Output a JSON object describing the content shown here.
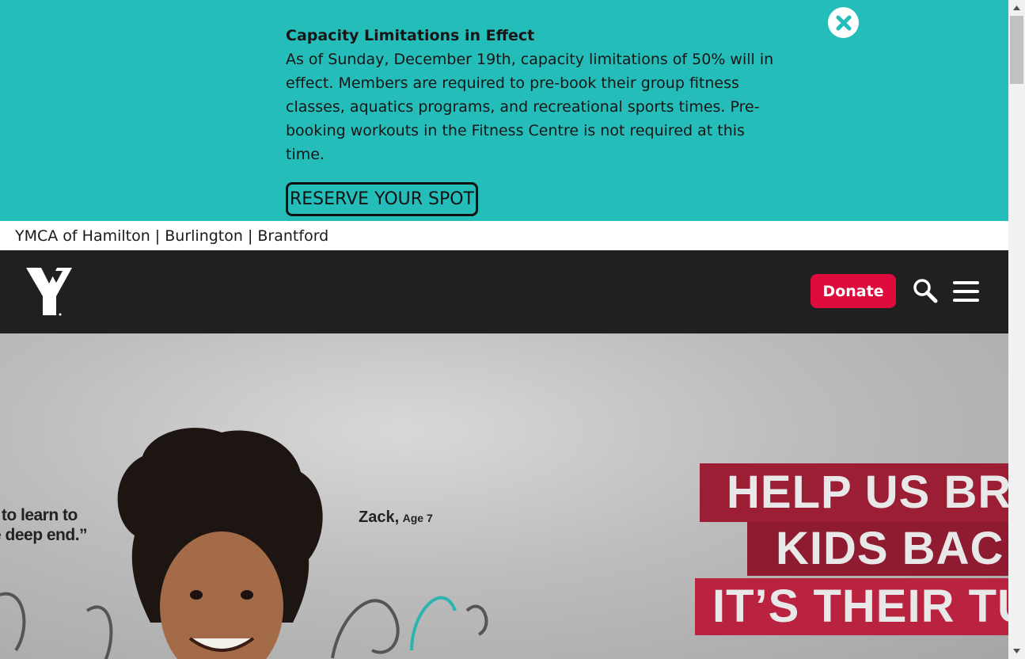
{
  "alert": {
    "title": "Capacity Limitations in Effect",
    "body": "As of Sunday, December 19th, capacity limitations of 50% will in effect. Members are required to pre-book their group fitness classes, aquatics programs, and recreational sports times. Pre-booking workouts in the Fitness Centre is not required at this time.",
    "reserve_label": "RESERVE YOUR SPOT",
    "close_icon": "close-icon",
    "bg_color": "#24bdb9"
  },
  "orgbar": {
    "text": "YMCA of Hamilton | Burlington | Brantford"
  },
  "header": {
    "logo_icon": "ymca-logo",
    "donate_label": "Donate",
    "donate_color": "#de0b3d",
    "search_icon": "search-icon",
    "menu_icon": "hamburger-menu-icon"
  },
  "hero": {
    "quote_line1": "t to learn to",
    "quote_line2": "e deep end.”",
    "attribution_name": "Zack,",
    "attribution_age": "Age 7",
    "headline_line1": "HELP US BR",
    "headline_line2": "KIDS BAC",
    "headline_line3": "IT’S THEIR TU"
  }
}
